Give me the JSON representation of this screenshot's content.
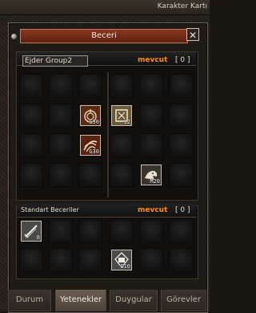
{
  "window": {
    "title": "Karakter Kartı"
  },
  "dialog": {
    "title": "Beceri",
    "close_glyph": "✕"
  },
  "skill_groups": {
    "tab_label": "Ejder Group2",
    "available_label": "mevcut",
    "available_count": "0"
  },
  "standard_skills": {
    "title": "Standart Beceriler",
    "available_label": "mevcut",
    "available_count": "0"
  },
  "skills_top": [
    {
      "icon": "spiral-whirlwind-icon",
      "level": "G30"
    },
    {
      "icon": "shield-armor-icon",
      "level": "12"
    },
    {
      "icon": "claw-strike-icon",
      "level": "G30"
    },
    {
      "icon": "dragon-head-icon",
      "level": "M20"
    }
  ],
  "skills_bottom": [
    {
      "icon": "sword-slash-icon",
      "level": "8"
    },
    {
      "icon": "fist-strike-icon",
      "level": "G10"
    }
  ],
  "tabs": [
    "Durum",
    "Yetenekler",
    "Duygular",
    "Görevler"
  ],
  "colors": {
    "accent": "#ff8a00",
    "header_red": "#7a2a18",
    "active_tab": "#5a4e44"
  }
}
